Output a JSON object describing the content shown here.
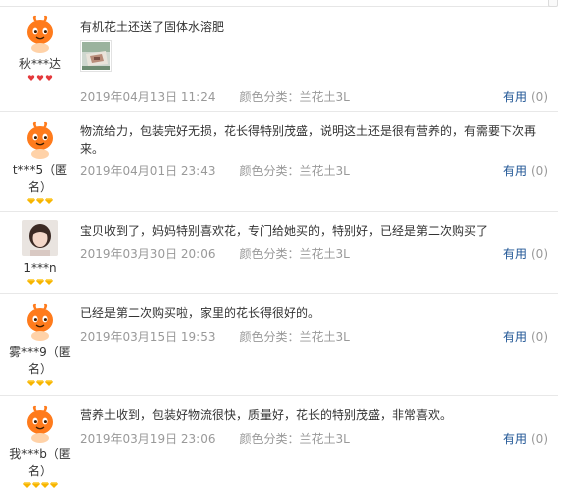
{
  "reviews": [
    {
      "username": "秋***达",
      "badge_type": "heart",
      "badge_count": 3,
      "avatar": "default-mascot",
      "text": "有机花土还送了固体水溶肥",
      "has_photo": true,
      "date": "2019年04月13日 11:24",
      "sku_label": "颜色分类：",
      "sku_value": "兰花土3L",
      "helpful_label": "有用",
      "helpful_count": "(0)"
    },
    {
      "username": "t***5（匿名）",
      "badge_type": "diamond",
      "badge_count": 3,
      "avatar": "default-mascot",
      "text": "物流给力，包装完好无损，花长得特别茂盛，说明这土还是很有营养的，有需要下次再来。",
      "has_photo": false,
      "date": "2019年04月01日 23:43",
      "sku_label": "颜色分类：",
      "sku_value": "兰花土3L",
      "helpful_label": "有用",
      "helpful_count": "(0)"
    },
    {
      "username": "1***n",
      "badge_type": "diamond",
      "badge_count": 3,
      "avatar": "user-photo",
      "text": "宝贝收到了，妈妈特别喜欢花，专门给她买的，特别好，已经是第二次购买了",
      "has_photo": false,
      "date": "2019年03月30日 20:06",
      "sku_label": "颜色分类：",
      "sku_value": "兰花土3L",
      "helpful_label": "有用",
      "helpful_count": "(0)"
    },
    {
      "username": "雾***9（匿名）",
      "badge_type": "diamond",
      "badge_count": 3,
      "avatar": "default-mascot",
      "text": "已经是第二次购买啦，家里的花长得很好的。",
      "has_photo": false,
      "date": "2019年03月15日 19:53",
      "sku_label": "颜色分类：",
      "sku_value": "兰花土3L",
      "helpful_label": "有用",
      "helpful_count": "(0)"
    },
    {
      "username": "我***b（匿名）",
      "badge_type": "diamond",
      "badge_count": 4,
      "avatar": "default-mascot",
      "text": "营养土收到，包装好物流很快，质量好，花长的特别茂盛，非常喜欢。",
      "has_photo": false,
      "date": "2019年03月19日 23:06",
      "sku_label": "颜色分类：",
      "sku_value": "兰花土3L",
      "helpful_label": "有用",
      "helpful_count": "(0)"
    }
  ],
  "colors": {
    "link": "#1e5494",
    "meta": "#999999",
    "badge_heart": "#e4393c",
    "badge_diamond": "#f7b500",
    "mascot": "#ff7b1c"
  }
}
